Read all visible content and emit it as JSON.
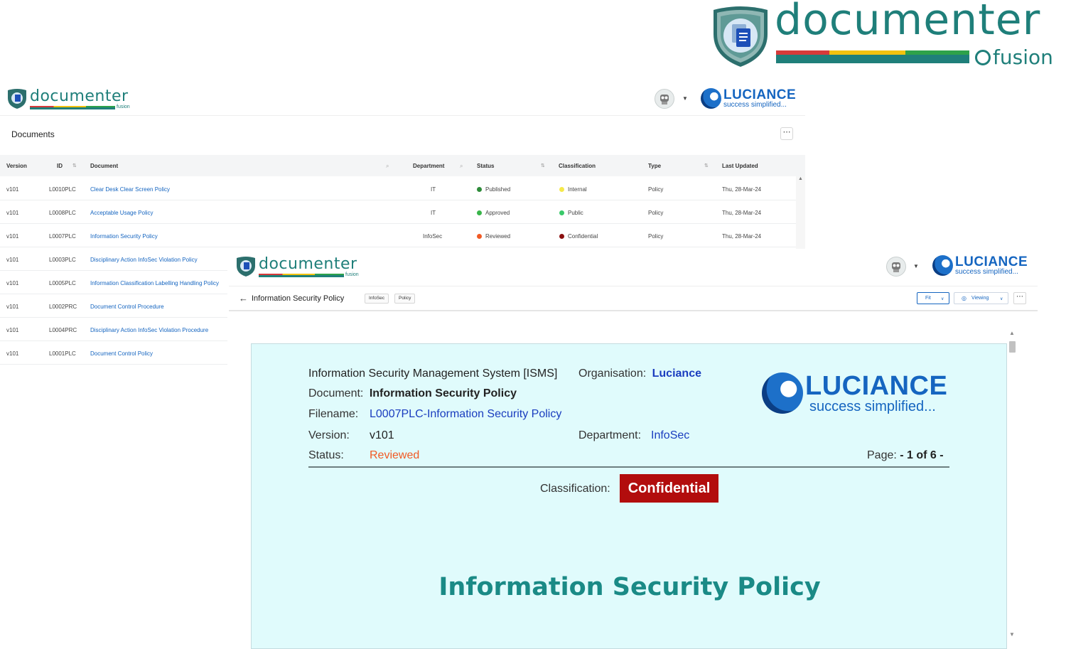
{
  "brand": {
    "product_name": "documenter",
    "product_suffix": "fusion",
    "stripe_colors": [
      "#d63a3a",
      "#f2c20f",
      "#2ea24a",
      "#1f7f7a",
      "#1f7f7a"
    ],
    "accent": "#1f7f7a"
  },
  "company": {
    "name": "LUCIANCE",
    "tagline": "success simplified..."
  },
  "documents_window": {
    "title": "Documents",
    "more_label": "⋯",
    "columns": {
      "version": "Version",
      "id": "ID",
      "document": "Document",
      "department": "Department",
      "status": "Status",
      "classification": "Classification",
      "type": "Type",
      "last_updated": "Last Updated"
    },
    "rows": [
      {
        "version": "v101",
        "id": "L0010PLC",
        "document": "Clear Desk Clear Screen Policy",
        "department": "IT",
        "status": "Published",
        "status_color": "#2e8b3a",
        "classification": "Internal",
        "class_color": "#f5e94a",
        "type": "Policy",
        "updated": "Thu, 28-Mar-24"
      },
      {
        "version": "v101",
        "id": "L0008PLC",
        "document": "Acceptable Usage Policy",
        "department": "IT",
        "status": "Approved",
        "status_color": "#39b54a",
        "classification": "Public",
        "class_color": "#3ac96a",
        "type": "Policy",
        "updated": "Thu, 28-Mar-24"
      },
      {
        "version": "v101",
        "id": "L0007PLC",
        "document": "Information Security Policy",
        "department": "InfoSec",
        "status": "Reviewed",
        "status_color": "#f15a24",
        "classification": "Confidential",
        "class_color": "#8b1010",
        "type": "Policy",
        "updated": "Thu, 28-Mar-24"
      },
      {
        "version": "v101",
        "id": "L0003PLC",
        "document": "Disciplinary Action InfoSec Violation Policy"
      },
      {
        "version": "v101",
        "id": "L0005PLC",
        "document": "Information Classification Labelling Handling Policy"
      },
      {
        "version": "v101",
        "id": "L0002PRC",
        "document": "Document Control Procedure"
      },
      {
        "version": "v101",
        "id": "L0004PRC",
        "document": "Disciplinary Action InfoSec Violation Procedure"
      },
      {
        "version": "v101",
        "id": "L0001PLC",
        "document": "Document Control Policy"
      }
    ]
  },
  "viewer_window": {
    "doc_title": "Information Security Policy",
    "chips": [
      "InfoSec",
      "Policy"
    ],
    "fit_label": "Fit",
    "viewing_label": "Viewing",
    "more_label": "⋯",
    "page": {
      "system": "Information Security Management System [ISMS]",
      "organisation_label": "Organisation:",
      "organisation": "Luciance",
      "document_label": "Document:",
      "document": "Information Security Policy",
      "filename_label": "Filename:",
      "filename": "L0007PLC-Information Security Policy",
      "version_label": "Version:",
      "version": "v101",
      "department_label": "Department:",
      "department": "InfoSec",
      "status_label": "Status:",
      "status": "Reviewed",
      "page_label": "Page:",
      "page_value": "- 1 of 6 -",
      "classification_label": "Classification:",
      "classification": "Confidential",
      "heading": "Information Security Policy"
    }
  }
}
